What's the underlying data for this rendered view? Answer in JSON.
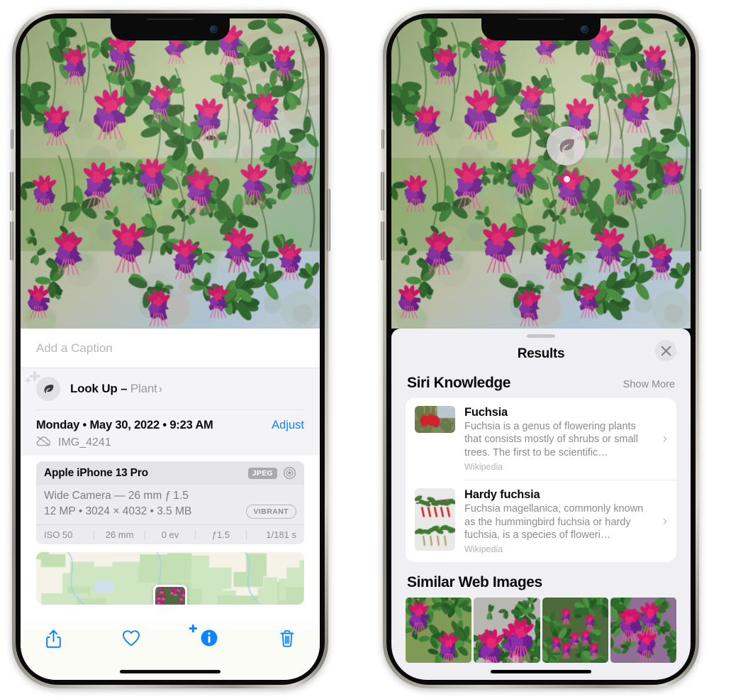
{
  "left_phone": {
    "name": "photos-detail-phone",
    "caption": {
      "placeholder": "Add a Caption",
      "value": ""
    },
    "lookup": {
      "label": "Look Up – ",
      "subject": "Plant",
      "icon": "leaf-icon",
      "chevron": "›"
    },
    "meta": {
      "date": "Monday • May 30, 2022 • 9:23 AM",
      "adjust_label": "Adjust",
      "filename": "IMG_4241",
      "cloud_icon": "icloud-slash-icon"
    },
    "camera_card": {
      "model": "Apple iPhone 13 Pro",
      "format_badge": "JPEG",
      "aperture_icon": "aperture-icon",
      "lens": "Wide Camera — 26 mm ƒ 1.5",
      "specs": "12 MP • 3024 × 4032 • 3.5 MB",
      "style_badge": "VIBRANT",
      "exif": [
        "ISO 50",
        "26 mm",
        "0 ev",
        "ƒ1.5",
        "1/181 s"
      ]
    },
    "toolbar": [
      {
        "name": "share-button",
        "icon": "share-icon"
      },
      {
        "name": "favorite-button",
        "icon": "heart-icon"
      },
      {
        "name": "info-button",
        "icon": "info-sparkle-icon"
      },
      {
        "name": "delete-button",
        "icon": "trash-icon"
      }
    ],
    "accent": "#0a84ff"
  },
  "right_phone": {
    "name": "visual-lookup-results-phone",
    "badge": {
      "icon": "leaf-icon",
      "label": "visual-look-up-badge"
    },
    "sheet": {
      "title": "Results",
      "close_icon": "close-icon",
      "sections": [
        {
          "title": "Siri Knowledge",
          "action": "Show More",
          "items": [
            {
              "title": "Fuchsia",
              "description": "Fuchsia is a genus of flowering plants that consists mostly of shrubs or small trees. The first to be scientific…",
              "source": "Wikipedia",
              "thumb": "fuchsia-red-flowers"
            },
            {
              "title": "Hardy fuchsia",
              "description": "Fuchsia magellanica, commonly known as the hummingbird fuchsia or hardy fuchsia, is a species of floweri…",
              "source": "Wikipedia",
              "thumb": "hardy-fuchsia-specimen"
            }
          ]
        },
        {
          "title": "Similar Web Images",
          "items": [
            {
              "thumb": "fuchsia-web-1"
            },
            {
              "thumb": "fuchsia-web-2"
            },
            {
              "thumb": "fuchsia-web-3"
            },
            {
              "thumb": "fuchsia-web-4"
            }
          ]
        }
      ]
    }
  }
}
